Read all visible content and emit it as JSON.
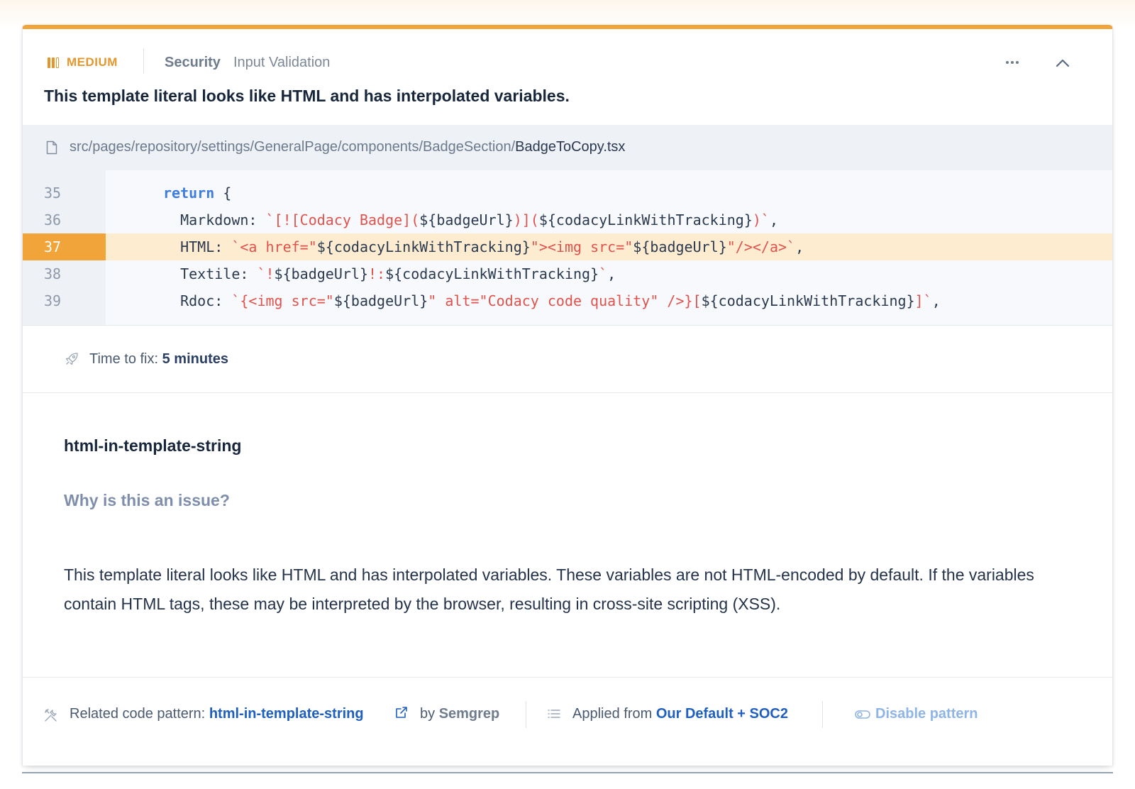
{
  "header": {
    "severity": "MEDIUM",
    "category": "Security",
    "subcategory": "Input Validation",
    "title": "This template literal looks like HTML and has interpolated variables.",
    "more_icon": "more-horizontal-icon",
    "collapse_icon": "chevron-up-icon"
  },
  "file": {
    "dir": "src/pages/repository/settings/GeneralPage/components/BadgeSection/",
    "name": "BadgeToCopy.tsx",
    "icon": "file-icon"
  },
  "code": {
    "highlighted_line": "37",
    "lines": [
      {
        "number": "35"
      },
      {
        "number": "36"
      },
      {
        "number": "37"
      },
      {
        "number": "38"
      },
      {
        "number": "39"
      }
    ]
  },
  "time_to_fix": {
    "label": "Time to fix:",
    "value": "5 minutes",
    "icon": "rocket-icon"
  },
  "pattern": {
    "name": "html-in-template-string",
    "why_heading": "Why is this an issue?",
    "description": "This template literal looks like HTML and has interpolated variables. These variables are not HTML-encoded by default. If the variables contain HTML tags, these may be interpreted by the browser, resulting in cross-site scripting (XSS)."
  },
  "footer": {
    "related_label": "Related code pattern:",
    "related_link": "html-in-template-string",
    "by_label": "by",
    "by_tool": "Semgrep",
    "applied_label": "Applied from",
    "applied_link": "Our Default + SOC2",
    "disable_label": "Disable pattern",
    "icons": [
      "tools-icon",
      "external-link-icon",
      "list-icon",
      "toggle-icon"
    ]
  },
  "colors": {
    "accent": "#f0a43a",
    "severity": "#e3982f",
    "link": "#1f5fbf",
    "string": "#e0534d",
    "keyword": "#3f7de0"
  }
}
